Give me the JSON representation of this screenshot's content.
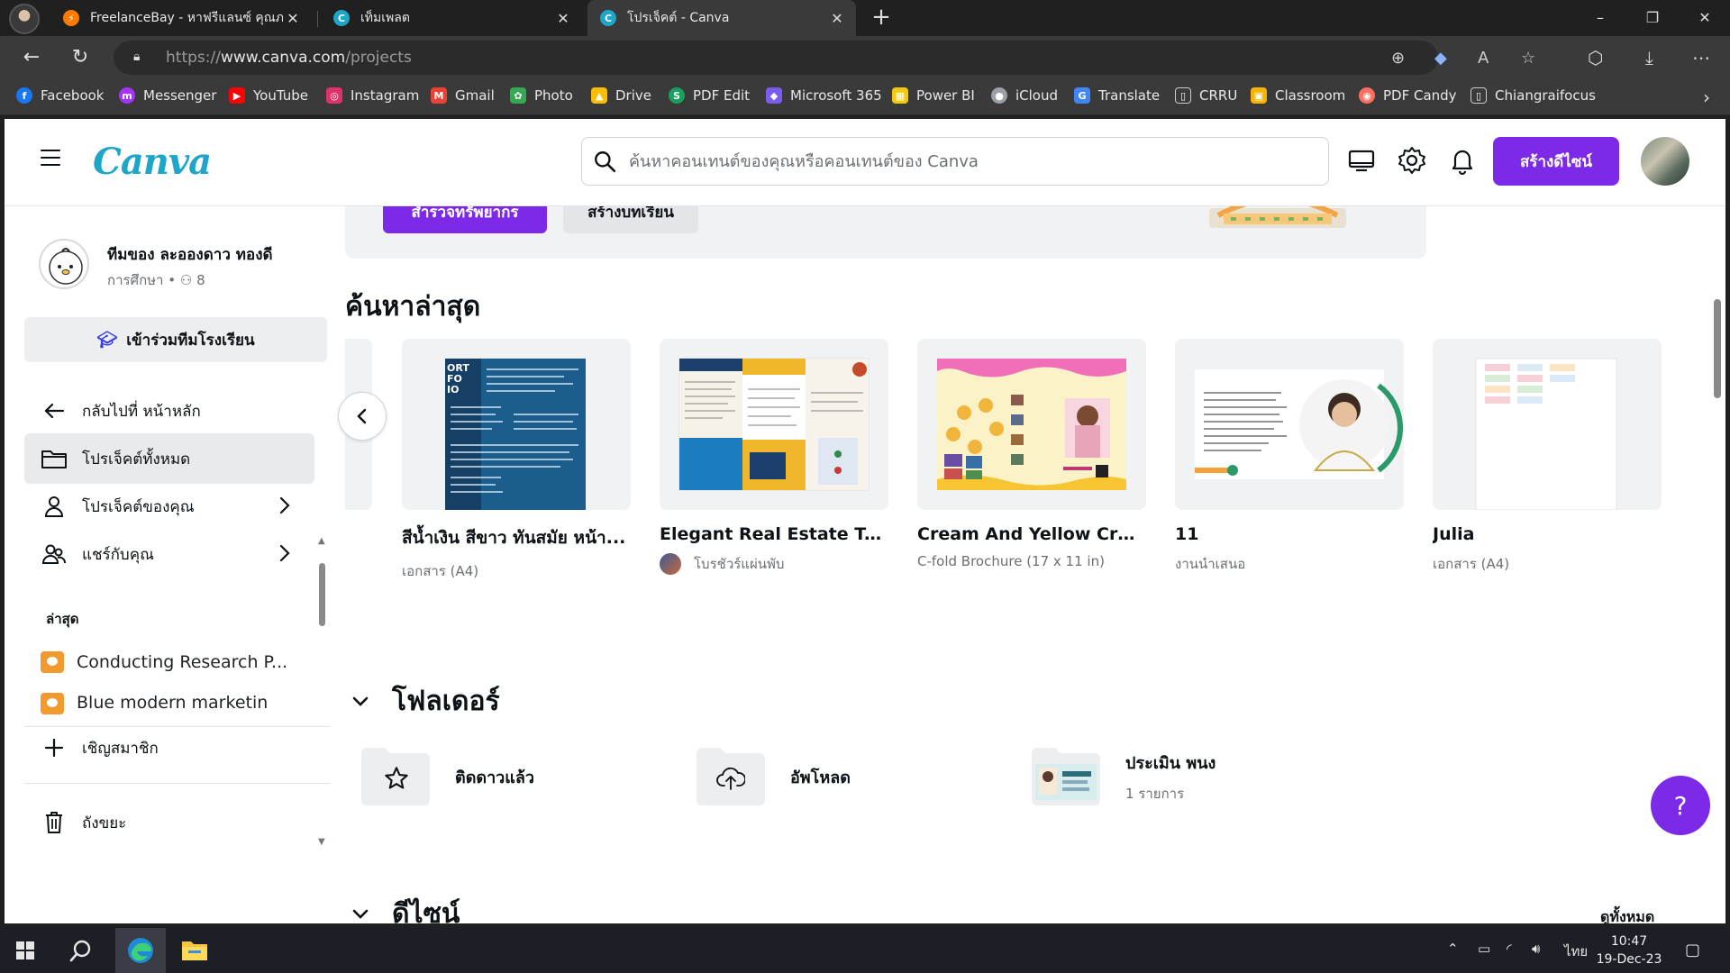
{
  "browser": {
    "tabs": [
      {
        "title": "FreelanceBay - หาฟรีแลนซ์ คุณภาพ",
        "close": "✕"
      },
      {
        "title": "เท็มเพลต",
        "close": "✕"
      },
      {
        "title": "โปรเจ็คต์ - Canva",
        "close": "✕"
      }
    ],
    "new_tab": "+",
    "url_scheme": "https://",
    "url_host": "www.canva.com",
    "url_path": "/projects",
    "bookmarks": [
      {
        "label": "Facebook",
        "color": "#1877f2",
        "glyph": "f"
      },
      {
        "label": "Messenger",
        "color": "#a334fa",
        "glyph": "m"
      },
      {
        "label": "YouTube",
        "color": "#ff0000",
        "glyph": "▶"
      },
      {
        "label": "Instagram",
        "color": "#e1306c",
        "glyph": "◎"
      },
      {
        "label": "Gmail",
        "color": "#ea4335",
        "glyph": "M"
      },
      {
        "label": "Photo",
        "color": "#34a853",
        "glyph": "✿"
      },
      {
        "label": "Drive",
        "color": "#fbbc04",
        "glyph": "▲"
      },
      {
        "label": "PDF Edit",
        "color": "#18a05e",
        "glyph": "S"
      },
      {
        "label": "Microsoft 365",
        "color": "#7b5cf0",
        "glyph": "◆"
      },
      {
        "label": "Power BI",
        "color": "#f2c811",
        "glyph": "▦"
      },
      {
        "label": "iCloud",
        "color": "#9aa0a6",
        "glyph": "●"
      },
      {
        "label": "Translate",
        "color": "#4285f4",
        "glyph": "G"
      },
      {
        "label": "CRRU",
        "color": "#3a3a3a",
        "glyph": "▯"
      },
      {
        "label": "Classroom",
        "color": "#f4b400",
        "glyph": "▣"
      },
      {
        "label": "PDF Candy",
        "color": "#ff6f61",
        "glyph": "◉"
      },
      {
        "label": "Chiangraifocus",
        "color": "#3a3a3a",
        "glyph": "▯"
      }
    ]
  },
  "canva": {
    "logo": "Canva",
    "search_placeholder": "ค้นหาคอนเทนต์ของคุณหรือคอนเทนต์ของ Canva",
    "create_button": "สร้างดีไซน์",
    "team": {
      "name": "ทีมของ ละอองดาว ทองดี",
      "type": "การศึกษา",
      "members": "8"
    },
    "join_school": "เข้าร่วมทีมโรงเรียน",
    "nav": {
      "back_home": "กลับไปที่ หน้าหลัก",
      "all_projects": "โปรเจ็คต์ทั้งหมด",
      "your_projects": "โปรเจ็คต์ของคุณ",
      "shared": "แชร์กับคุณ",
      "recent_label": "ล่าสุด",
      "recent_items": [
        "Conducting Research P...",
        "Blue modern marketin"
      ],
      "invite": "เชิญสมาชิก",
      "trash": "ถังขยะ"
    },
    "banner": {
      "btn_explore": "สำรวจทรัพยากร",
      "btn_create_lesson": "สร้างบทเรียน"
    },
    "recent_heading": "ค้นหาล่าสุด",
    "recent_designs": [
      {
        "title": "สีน้ำเงิน สีขาว ทันสมัย หน้า...",
        "subtitle": "เอกสาร (A4)"
      },
      {
        "title": "Elegant Real Estate Trifol...",
        "subtitle": "โบรชัวร์แผ่นพับ"
      },
      {
        "title": "Cream And Yellow Creati...",
        "subtitle": "C-fold Brochure (17 x 11 in)"
      },
      {
        "title": "11",
        "subtitle": "งานนำเสนอ"
      },
      {
        "title": "Julia",
        "subtitle": "เอกสาร (A4)"
      }
    ],
    "folders_heading": "โฟลเดอร์",
    "folders": [
      {
        "name": "ติดดาวแล้ว",
        "sub": ""
      },
      {
        "name": "อัพโหลด",
        "sub": ""
      },
      {
        "name": "ประเมิน พนง",
        "sub": "1 รายการ"
      }
    ],
    "designs_heading": "ดีไซน์",
    "see_all": "ดูทั้งหมด",
    "help": "?"
  },
  "taskbar": {
    "ime": "ไทย",
    "time": "10:47",
    "date": "19-Dec-23"
  }
}
